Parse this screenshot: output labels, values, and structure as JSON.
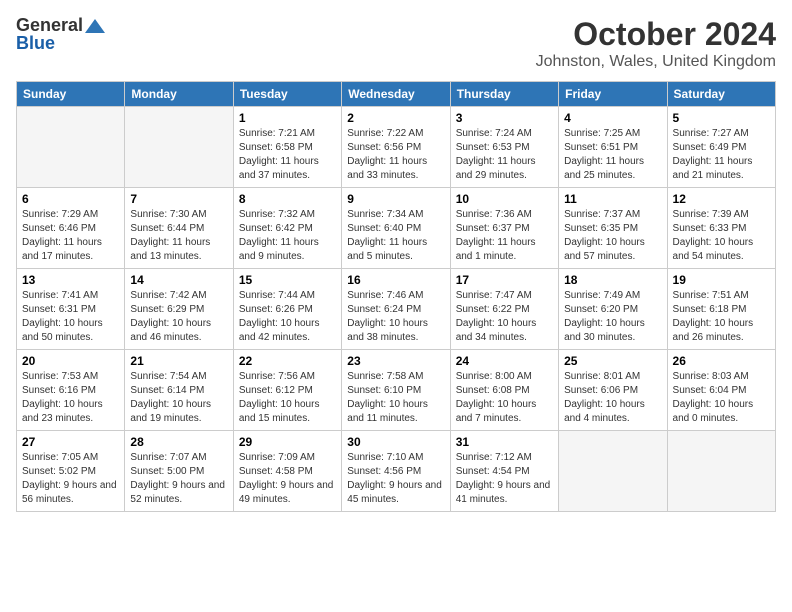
{
  "header": {
    "logo_general": "General",
    "logo_blue": "Blue",
    "month": "October 2024",
    "location": "Johnston, Wales, United Kingdom"
  },
  "days_of_week": [
    "Sunday",
    "Monday",
    "Tuesday",
    "Wednesday",
    "Thursday",
    "Friday",
    "Saturday"
  ],
  "weeks": [
    [
      {
        "day": "",
        "info": ""
      },
      {
        "day": "",
        "info": ""
      },
      {
        "day": "1",
        "info": "Sunrise: 7:21 AM\nSunset: 6:58 PM\nDaylight: 11 hours and 37 minutes."
      },
      {
        "day": "2",
        "info": "Sunrise: 7:22 AM\nSunset: 6:56 PM\nDaylight: 11 hours and 33 minutes."
      },
      {
        "day": "3",
        "info": "Sunrise: 7:24 AM\nSunset: 6:53 PM\nDaylight: 11 hours and 29 minutes."
      },
      {
        "day": "4",
        "info": "Sunrise: 7:25 AM\nSunset: 6:51 PM\nDaylight: 11 hours and 25 minutes."
      },
      {
        "day": "5",
        "info": "Sunrise: 7:27 AM\nSunset: 6:49 PM\nDaylight: 11 hours and 21 minutes."
      }
    ],
    [
      {
        "day": "6",
        "info": "Sunrise: 7:29 AM\nSunset: 6:46 PM\nDaylight: 11 hours and 17 minutes."
      },
      {
        "day": "7",
        "info": "Sunrise: 7:30 AM\nSunset: 6:44 PM\nDaylight: 11 hours and 13 minutes."
      },
      {
        "day": "8",
        "info": "Sunrise: 7:32 AM\nSunset: 6:42 PM\nDaylight: 11 hours and 9 minutes."
      },
      {
        "day": "9",
        "info": "Sunrise: 7:34 AM\nSunset: 6:40 PM\nDaylight: 11 hours and 5 minutes."
      },
      {
        "day": "10",
        "info": "Sunrise: 7:36 AM\nSunset: 6:37 PM\nDaylight: 11 hours and 1 minute."
      },
      {
        "day": "11",
        "info": "Sunrise: 7:37 AM\nSunset: 6:35 PM\nDaylight: 10 hours and 57 minutes."
      },
      {
        "day": "12",
        "info": "Sunrise: 7:39 AM\nSunset: 6:33 PM\nDaylight: 10 hours and 54 minutes."
      }
    ],
    [
      {
        "day": "13",
        "info": "Sunrise: 7:41 AM\nSunset: 6:31 PM\nDaylight: 10 hours and 50 minutes."
      },
      {
        "day": "14",
        "info": "Sunrise: 7:42 AM\nSunset: 6:29 PM\nDaylight: 10 hours and 46 minutes."
      },
      {
        "day": "15",
        "info": "Sunrise: 7:44 AM\nSunset: 6:26 PM\nDaylight: 10 hours and 42 minutes."
      },
      {
        "day": "16",
        "info": "Sunrise: 7:46 AM\nSunset: 6:24 PM\nDaylight: 10 hours and 38 minutes."
      },
      {
        "day": "17",
        "info": "Sunrise: 7:47 AM\nSunset: 6:22 PM\nDaylight: 10 hours and 34 minutes."
      },
      {
        "day": "18",
        "info": "Sunrise: 7:49 AM\nSunset: 6:20 PM\nDaylight: 10 hours and 30 minutes."
      },
      {
        "day": "19",
        "info": "Sunrise: 7:51 AM\nSunset: 6:18 PM\nDaylight: 10 hours and 26 minutes."
      }
    ],
    [
      {
        "day": "20",
        "info": "Sunrise: 7:53 AM\nSunset: 6:16 PM\nDaylight: 10 hours and 23 minutes."
      },
      {
        "day": "21",
        "info": "Sunrise: 7:54 AM\nSunset: 6:14 PM\nDaylight: 10 hours and 19 minutes."
      },
      {
        "day": "22",
        "info": "Sunrise: 7:56 AM\nSunset: 6:12 PM\nDaylight: 10 hours and 15 minutes."
      },
      {
        "day": "23",
        "info": "Sunrise: 7:58 AM\nSunset: 6:10 PM\nDaylight: 10 hours and 11 minutes."
      },
      {
        "day": "24",
        "info": "Sunrise: 8:00 AM\nSunset: 6:08 PM\nDaylight: 10 hours and 7 minutes."
      },
      {
        "day": "25",
        "info": "Sunrise: 8:01 AM\nSunset: 6:06 PM\nDaylight: 10 hours and 4 minutes."
      },
      {
        "day": "26",
        "info": "Sunrise: 8:03 AM\nSunset: 6:04 PM\nDaylight: 10 hours and 0 minutes."
      }
    ],
    [
      {
        "day": "27",
        "info": "Sunrise: 7:05 AM\nSunset: 5:02 PM\nDaylight: 9 hours and 56 minutes."
      },
      {
        "day": "28",
        "info": "Sunrise: 7:07 AM\nSunset: 5:00 PM\nDaylight: 9 hours and 52 minutes."
      },
      {
        "day": "29",
        "info": "Sunrise: 7:09 AM\nSunset: 4:58 PM\nDaylight: 9 hours and 49 minutes."
      },
      {
        "day": "30",
        "info": "Sunrise: 7:10 AM\nSunset: 4:56 PM\nDaylight: 9 hours and 45 minutes."
      },
      {
        "day": "31",
        "info": "Sunrise: 7:12 AM\nSunset: 4:54 PM\nDaylight: 9 hours and 41 minutes."
      },
      {
        "day": "",
        "info": ""
      },
      {
        "day": "",
        "info": ""
      }
    ]
  ]
}
